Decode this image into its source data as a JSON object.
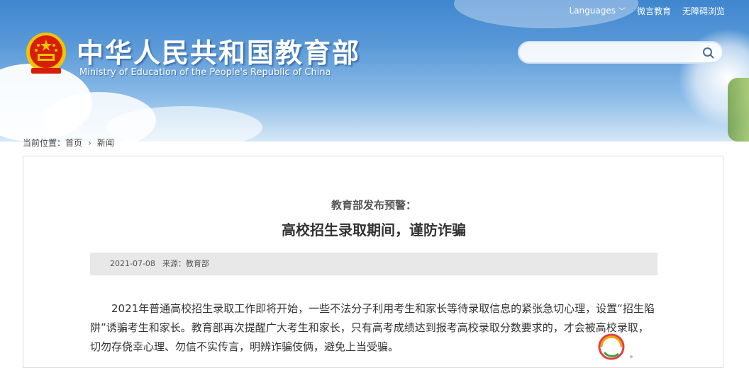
{
  "header": {
    "title_cn": "中华人民共和国教育部",
    "title_en": "Ministry of Education of the People's Republic of China",
    "topnav": {
      "languages": "Languages",
      "weibo": "微言教育",
      "accessibility": "无障碍浏览"
    },
    "search": {
      "placeholder": ""
    }
  },
  "breadcrumb": {
    "prefix": "当前位置：",
    "home": "首页",
    "current": "新闻"
  },
  "article": {
    "subtitle": "教育部发布预警：",
    "headline": "高校招生录取期间，谨防诈骗",
    "date": "2021-07-08",
    "source": "来源：教育部",
    "body": "2021年普通高校招生录取工作即将开始，一些不法分子利用考生和家长等待录取信息的紧张急切心理，设置“招生陷阱”诱骗考生和家长。教育部再次提醒广大考生和家长，只有高考成绩达到报考高校录取分数要求的，才会被高校录取，切勿存侥幸心理、勿信不实传言，明辨诈骗伎俩，避免上当受骗。"
  },
  "colors": {
    "sky_top": "#3f86cf",
    "emblem_red": "#d81e06",
    "emblem_gold": "#f5c400"
  }
}
